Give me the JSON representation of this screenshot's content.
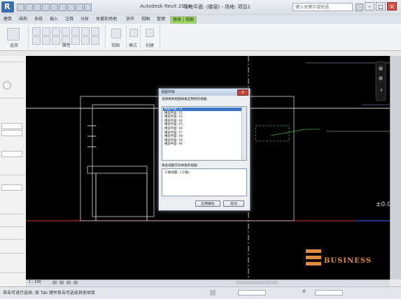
{
  "window": {
    "title": "Autodesk Revit 2014 -",
    "doc_title": "场地平面: (楼层) - 场地: 项目1",
    "search_placeholder": "键入关键字或短语",
    "minimize": "–",
    "maximize": "□",
    "close": "×"
  },
  "app_menu_letter": "R",
  "ribbon": {
    "tabs": [
      "建筑",
      "结构",
      "系统",
      "插入",
      "注释",
      "分析",
      "体量和场地",
      "协作",
      "视图",
      "管理",
      "修改 | 视图"
    ],
    "active_tab_index": 10,
    "panels": [
      "选择",
      "属性",
      "视图",
      "模式",
      "创建"
    ]
  },
  "statusbar": {
    "text": "单击可进行选择; 按 Tab 键并单击可选择其他项目",
    "scale": "1 : 100",
    "zero": ":0"
  },
  "dialog": {
    "title": "视图样板",
    "close": "×",
    "prompt": "选择要将视图样板应用到的视图:",
    "list_items": [
      "楼层平面: F1",
      "楼层平面: F2",
      "楼层平面: F3",
      "楼层平面: F4",
      "楼层平面: F5",
      "楼层平面: F6",
      "楼层平面: F7",
      "楼层平面: F8",
      "楼层平面: F9",
      "楼层平面: RF"
    ],
    "selected_index": 0,
    "sub_prompt": "将此视图作为样板的视图:",
    "sub_item": "三维视图: {三维}",
    "buttons": {
      "ok": "应用属性",
      "cancel": "取消"
    }
  },
  "canvas": {
    "elevation_label": "±0.0",
    "watermark": "BUSINESS"
  },
  "colors": {
    "ribbon_context_tab": "#9fd36a",
    "watermark": "#e08a3c",
    "canvas_bg": "#000000",
    "selection": "#3b77c9"
  }
}
